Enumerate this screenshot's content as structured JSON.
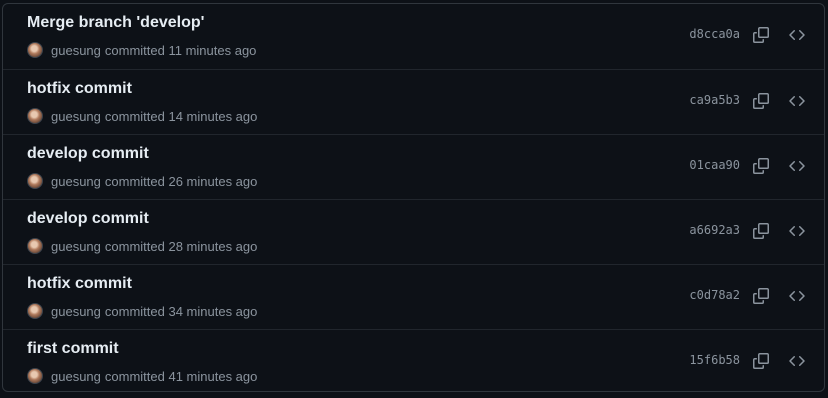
{
  "commits": [
    {
      "title": "Merge branch 'develop'",
      "author": "guesung",
      "action": "committed",
      "time": "11 minutes ago",
      "sha": "d8cca0a"
    },
    {
      "title": "hotfix commit",
      "author": "guesung",
      "action": "committed",
      "time": "14 minutes ago",
      "sha": "ca9a5b3"
    },
    {
      "title": "develop commit",
      "author": "guesung",
      "action": "committed",
      "time": "26 minutes ago",
      "sha": "01caa90"
    },
    {
      "title": "develop commit",
      "author": "guesung",
      "action": "committed",
      "time": "28 minutes ago",
      "sha": "a6692a3"
    },
    {
      "title": "hotfix commit",
      "author": "guesung",
      "action": "committed",
      "time": "34 minutes ago",
      "sha": "c0d78a2"
    },
    {
      "title": "first commit",
      "author": "guesung",
      "action": "committed",
      "time": "41 minutes ago",
      "sha": "15f6b58"
    }
  ],
  "icons": {
    "copy": "copy-icon",
    "browse": "code-icon",
    "avatar": "user-avatar"
  },
  "colors": {
    "background": "#0d1117",
    "border": "#30363d",
    "title": "#e6edf3",
    "muted": "#8b949e"
  }
}
